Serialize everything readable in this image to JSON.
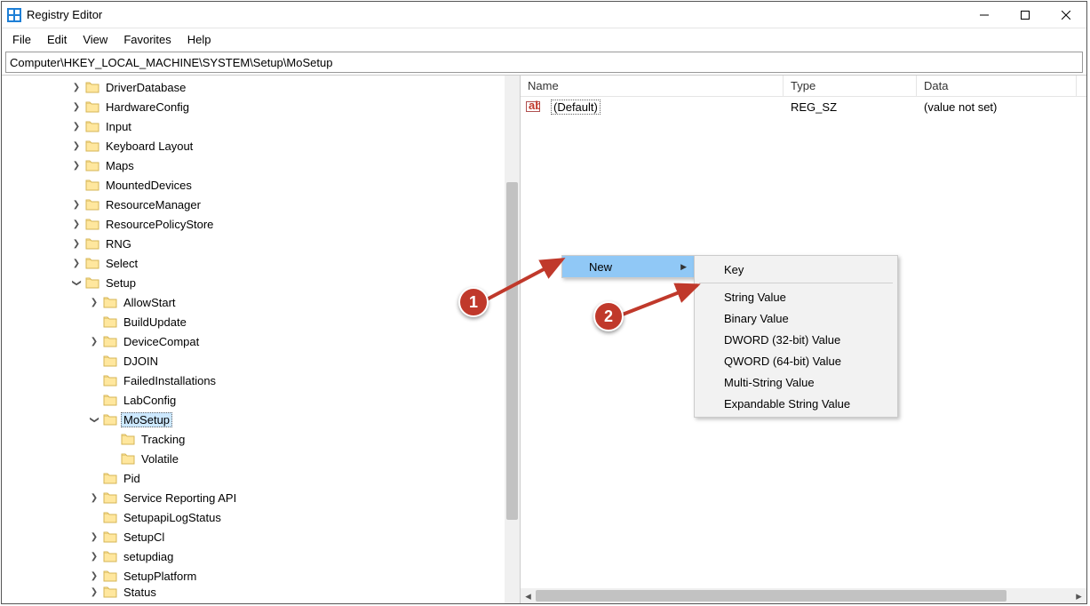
{
  "window": {
    "title": "Registry Editor"
  },
  "menubar": [
    "File",
    "Edit",
    "View",
    "Favorites",
    "Help"
  ],
  "addressbar": "Computer\\HKEY_LOCAL_MACHINE\\SYSTEM\\Setup\\MoSetup",
  "tree": [
    {
      "indent": 0,
      "toggle": ">",
      "label": "DriverDatabase"
    },
    {
      "indent": 0,
      "toggle": ">",
      "label": "HardwareConfig"
    },
    {
      "indent": 0,
      "toggle": ">",
      "label": "Input"
    },
    {
      "indent": 0,
      "toggle": ">",
      "label": "Keyboard Layout"
    },
    {
      "indent": 0,
      "toggle": ">",
      "label": "Maps"
    },
    {
      "indent": 0,
      "toggle": "",
      "label": "MountedDevices"
    },
    {
      "indent": 0,
      "toggle": ">",
      "label": "ResourceManager"
    },
    {
      "indent": 0,
      "toggle": ">",
      "label": "ResourcePolicyStore"
    },
    {
      "indent": 0,
      "toggle": ">",
      "label": "RNG"
    },
    {
      "indent": 0,
      "toggle": ">",
      "label": "Select"
    },
    {
      "indent": 0,
      "toggle": "v",
      "label": "Setup"
    },
    {
      "indent": 1,
      "toggle": ">",
      "label": "AllowStart"
    },
    {
      "indent": 1,
      "toggle": "",
      "label": "BuildUpdate"
    },
    {
      "indent": 1,
      "toggle": ">",
      "label": "DeviceCompat"
    },
    {
      "indent": 1,
      "toggle": "",
      "label": "DJOIN"
    },
    {
      "indent": 1,
      "toggle": "",
      "label": "FailedInstallations"
    },
    {
      "indent": 1,
      "toggle": "",
      "label": "LabConfig"
    },
    {
      "indent": 1,
      "toggle": "v",
      "label": "MoSetup",
      "selected": true
    },
    {
      "indent": 2,
      "toggle": "",
      "label": "Tracking"
    },
    {
      "indent": 2,
      "toggle": "",
      "label": "Volatile"
    },
    {
      "indent": 1,
      "toggle": "",
      "label": "Pid"
    },
    {
      "indent": 1,
      "toggle": ">",
      "label": "Service Reporting API"
    },
    {
      "indent": 1,
      "toggle": "",
      "label": "SetupapiLogStatus"
    },
    {
      "indent": 1,
      "toggle": ">",
      "label": "SetupCl"
    },
    {
      "indent": 1,
      "toggle": ">",
      "label": "setupdiag"
    },
    {
      "indent": 1,
      "toggle": ">",
      "label": "SetupPlatform"
    },
    {
      "indent": 1,
      "toggle": ">",
      "label": "Status",
      "cut": true
    }
  ],
  "list": {
    "columns": {
      "name": "Name",
      "type": "Type",
      "data": "Data"
    },
    "colwidths": {
      "name": 296,
      "type": 150,
      "data": 180
    },
    "rows": [
      {
        "name": "(Default)",
        "type": "REG_SZ",
        "data": "(value not set)"
      }
    ]
  },
  "context_primary": {
    "label": "New"
  },
  "context_sub": [
    {
      "label": "Key",
      "sep_after": true
    },
    {
      "label": "String Value"
    },
    {
      "label": "Binary Value"
    },
    {
      "label": "DWORD (32-bit) Value"
    },
    {
      "label": "QWORD (64-bit) Value"
    },
    {
      "label": "Multi-String Value"
    },
    {
      "label": "Expandable String Value"
    }
  ],
  "badges": {
    "one": "1",
    "two": "2"
  }
}
